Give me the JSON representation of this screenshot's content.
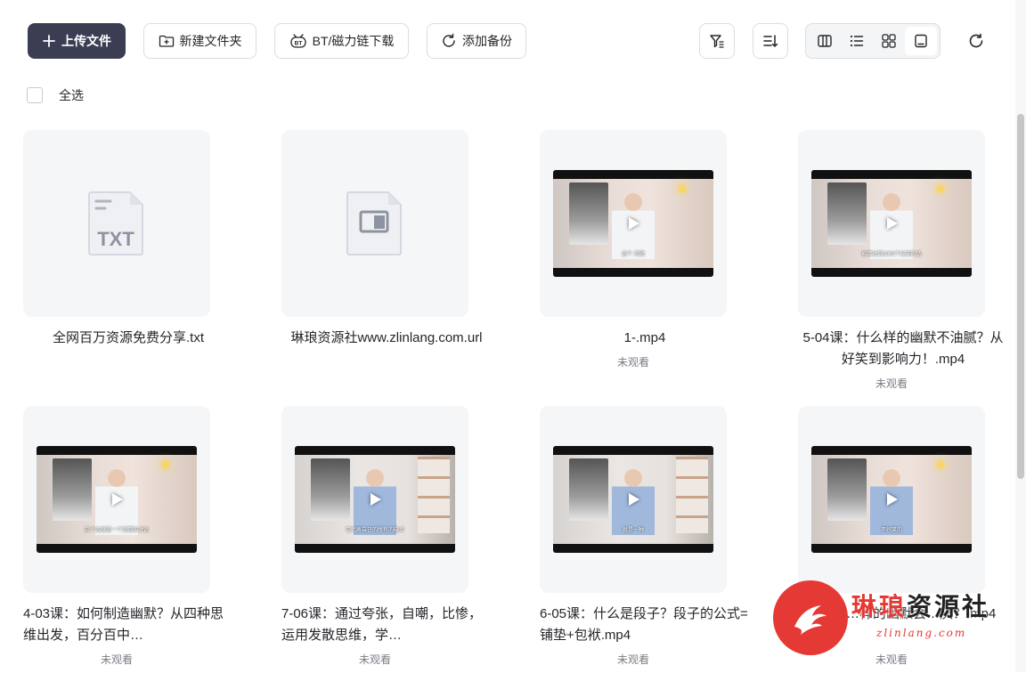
{
  "toolbar": {
    "upload_label": "上传文件",
    "new_folder_label": "新建文件夹",
    "bt_label": "BT/磁力链下载",
    "bt_badge": "BT",
    "backup_label": "添加备份",
    "filter_icon": "filter-icon",
    "sort_icon": "sort-icon",
    "views": [
      "column-view",
      "list-view",
      "grid-view",
      "single-view"
    ],
    "active_view": "single-view",
    "refresh_icon": "refresh-icon"
  },
  "select_all_label": "全选",
  "files": [
    {
      "name": "全网百万资源免费分享.txt",
      "type": "txt",
      "icon_label": "TXT",
      "meta": ""
    },
    {
      "name": "琳琅资源社www.zlinlang.com.url",
      "type": "url",
      "meta": ""
    },
    {
      "name": "1-.mp4",
      "type": "video",
      "meta": "未观看",
      "caption": "这个 问题",
      "scene": "warm"
    },
    {
      "name": "5-04课：什么样的幽默不油腻？从好笑到影响力！.mp4",
      "type": "video",
      "meta": "未观看",
      "caption": "能否达到1000个标准的话",
      "scene": "warm"
    },
    {
      "name": "4-03课：如何制造幽默？从四种思维出发，百分百中…",
      "type": "video",
      "meta": "未观看",
      "caption": "这个态度是一个完整的对话",
      "scene": "warm"
    },
    {
      "name": "7-06课：通过夸张，自嘲，比惨，运用发散思维，学…",
      "type": "video",
      "meta": "未观看",
      "caption": "它代表自己的所有的缺点",
      "scene": "cool"
    },
    {
      "name": "6-05课：什么是段子？段子的公式=铺垫+包袱.mp4",
      "type": "video",
      "meta": "未观看",
      "caption": "就是一种",
      "scene": "cool"
    },
    {
      "name": "…样的幽默会…厌？.mp4",
      "type": "video",
      "meta": "未观看",
      "caption": "不好笑的",
      "scene": "warm"
    }
  ],
  "watermark": {
    "title_red": "琳琅",
    "title_dark": "资源社",
    "subtitle": "zlinlang.com"
  },
  "colors": {
    "primary": "#3b3d52",
    "brand_red": "#e53935",
    "thumb_bg": "#f5f6f8"
  }
}
